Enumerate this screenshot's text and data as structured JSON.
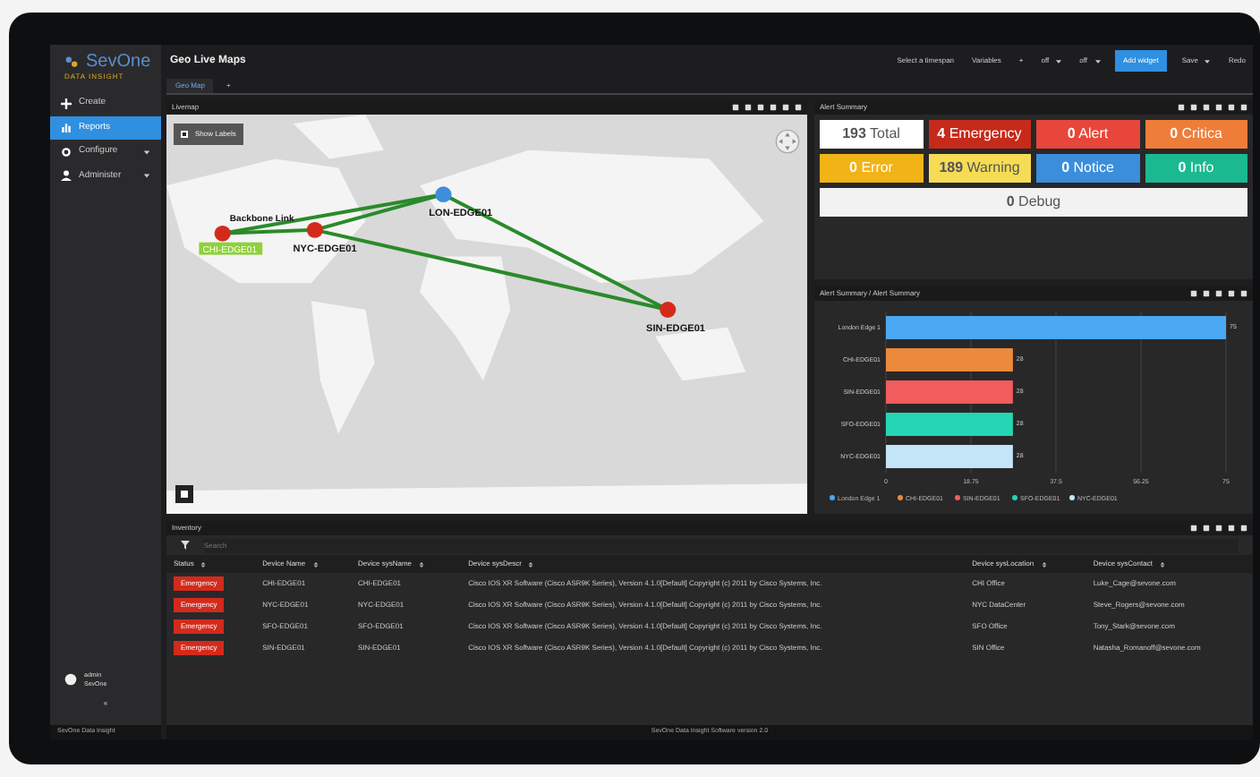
{
  "sidebar": {
    "logo": "SevOne",
    "tagline": "DATA INSIGHT",
    "items": [
      {
        "label": "Create",
        "selected": false,
        "expandable": false
      },
      {
        "label": "Reports",
        "selected": true,
        "expandable": false
      },
      {
        "label": "Configure",
        "selected": false,
        "expandable": true
      },
      {
        "label": "Administer",
        "selected": false,
        "expandable": true
      }
    ],
    "user": {
      "name": "admin",
      "org": "SevOne"
    },
    "collapse": "«"
  },
  "header": {
    "title": "Geo Live Maps",
    "toolbar": [
      {
        "kind": "text",
        "label": "Select a timespan"
      },
      {
        "kind": "text",
        "label": "Variables"
      },
      {
        "kind": "text",
        "label": "+"
      },
      {
        "kind": "dropdown",
        "label": "off"
      },
      {
        "kind": "dropdown",
        "label": "off"
      },
      {
        "kind": "primary",
        "label": "Add widget"
      },
      {
        "kind": "dropdown",
        "label": "Save"
      },
      {
        "kind": "text",
        "label": "Redo"
      }
    ]
  },
  "tabs": [
    {
      "label": "Geo Map",
      "selected": true
    },
    {
      "label": "+",
      "selected": false
    }
  ],
  "map_panel": {
    "title": "Livemap",
    "show_labels": {
      "label": "Show Labels",
      "checked": false
    },
    "nodes": [
      {
        "label": "CHI-EDGE01",
        "color": "#d42a1c",
        "highlight": true
      },
      {
        "label": "NYC-EDGE01",
        "color": "#d42a1c",
        "highlight": false
      },
      {
        "label": "LON-EDGE01",
        "color": "#3d8fdc",
        "highlight": false
      },
      {
        "label": "SIN-EDGE01",
        "color": "#d42a1c",
        "highlight": false
      }
    ],
    "link_label": "Backbone Link"
  },
  "alert_panel": {
    "title": "Alert Summary",
    "tiles": [
      {
        "text": "**193** Total",
        "color": "#ffffff"
      },
      {
        "text": "**4** Emergency",
        "color": "#c62a1a"
      },
      {
        "text": "**0** Alert",
        "color": "#e8463a"
      },
      {
        "text": "**0** Critica",
        "color": "#ef7d3a"
      },
      {
        "text": "**0** Error",
        "color": "#f2b316"
      },
      {
        "text": "**189** Warning",
        "color": "#f6dc55"
      },
      {
        "text": "**0** Notice",
        "color": "#3a8edb"
      },
      {
        "text": "**0** Info",
        "color": "#1bb98f"
      },
      {
        "text": "**0** Debug",
        "color": "#f2f2f2"
      }
    ]
  },
  "chart_panel": {
    "title": "Alert Summary / Alert Summary",
    "chart_data": {
      "type": "bar",
      "orientation": "horizontal",
      "stacked": true,
      "categories": [
        "London Edge 1",
        "CHI-EDGE01",
        "SIN-EDGE01",
        "SFO-EDGE01",
        "NYC-EDGE01"
      ],
      "series": [
        {
          "name": "London Edge 1",
          "color": "#4aa9f2",
          "values": [
            75,
            null,
            null,
            null,
            null
          ]
        },
        {
          "name": "CHI-EDGE01",
          "color": "#ec8a3c",
          "values": [
            null,
            28,
            null,
            null,
            null
          ]
        },
        {
          "name": "SIN-EDGE01",
          "color": "#f25c5c",
          "values": [
            null,
            null,
            28,
            null,
            null
          ]
        },
        {
          "name": "SFO-EDGE01",
          "color": "#25d6b5",
          "values": [
            null,
            null,
            null,
            28,
            null
          ]
        },
        {
          "name": "NYC-EDGE01",
          "color": "#c4e5f8",
          "values": [
            null,
            null,
            null,
            null,
            28
          ]
        }
      ],
      "xlim": [
        0,
        75
      ],
      "xticks": [
        0,
        18.75,
        37.5,
        56.25,
        75
      ],
      "data_labels": true,
      "grid": true,
      "legend": true
    }
  },
  "table_panel": {
    "title": "Inventory",
    "search_placeholder": "Search",
    "columns": [
      "Status",
      "Device Name",
      "Device sysName",
      "Device sysDescr",
      "Device sysLocation",
      "Device sysContact"
    ],
    "rows": [
      [
        "Emergency",
        "CHI-EDGE01",
        "CHI-EDGE01",
        "Cisco IOS XR Software (Cisco ASR9K Series), Version 4.1.0[Default] Copyright (c) 2011 by Cisco Systems, Inc.",
        "CHI Office",
        "Luke_Cage@sevone.com"
      ],
      [
        "Emergency",
        "NYC-EDGE01",
        "NYC-EDGE01",
        "Cisco IOS XR Software (Cisco ASR9K Series), Version 4.1.0[Default] Copyright (c) 2011 by Cisco Systems, Inc.",
        "NYC DataCenter",
        "Steve_Rogers@sevone.com"
      ],
      [
        "Emergency",
        "SFO-EDGE01",
        "SFO-EDGE01",
        "Cisco IOS XR Software (Cisco ASR9K Series), Version 4.1.0[Default] Copyright (c) 2011 by Cisco Systems, Inc.",
        "SFO Office",
        "Tony_Stark@sevone.com"
      ],
      [
        "Emergency",
        "SIN-EDGE01",
        "SIN-EDGE01",
        "Cisco IOS XR Software (Cisco ASR9K Series), Version 4.1.0[Default] Copyright (c) 2011 by Cisco Systems, Inc.",
        "SIN Office",
        "Natasha_Romanoff@sevone.com"
      ]
    ]
  },
  "status_bar": {
    "left": "SevOne Data Insight",
    "center": "SevOne Data Insight Software version 2.0"
  }
}
